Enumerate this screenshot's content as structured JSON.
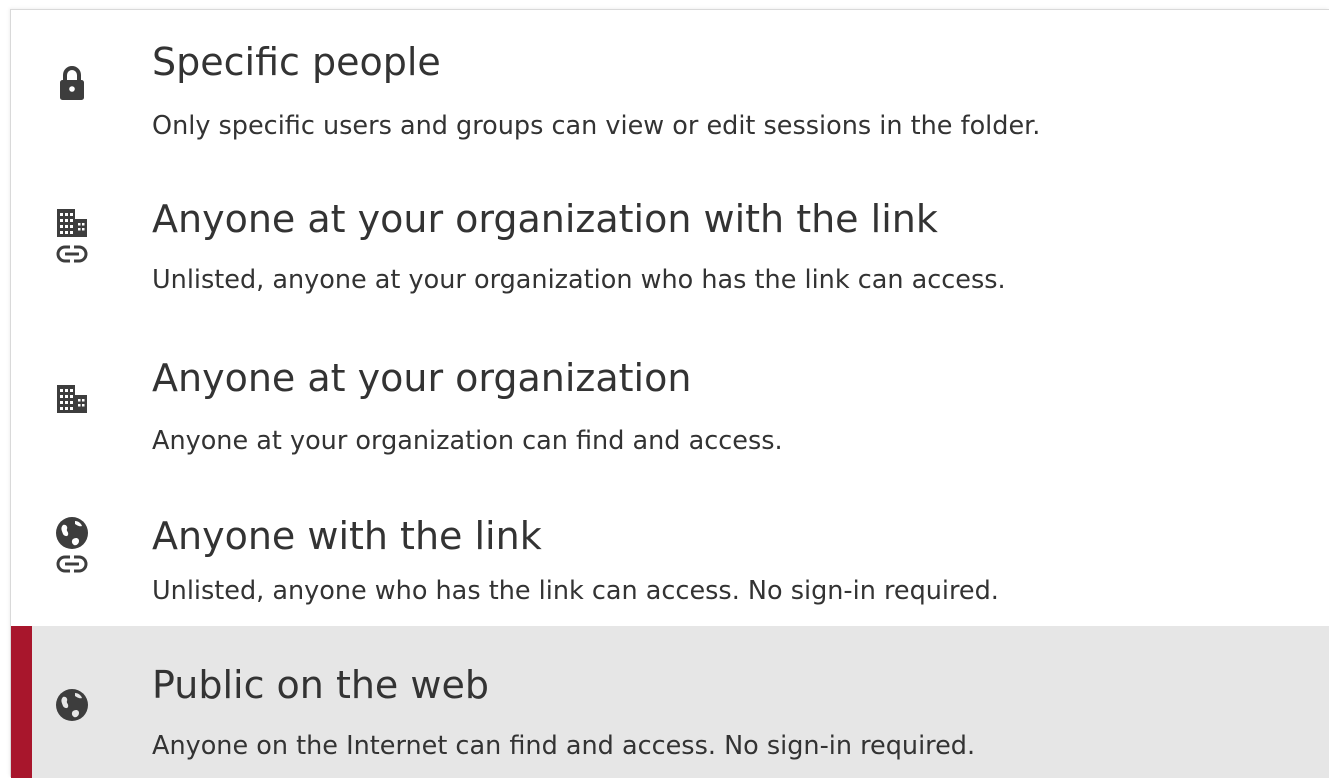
{
  "options": [
    {
      "title": "Specific people",
      "description": "Only specific users and groups can view or edit sessions in the folder.",
      "icons": [
        "lock-icon"
      ],
      "selected": false
    },
    {
      "title": "Anyone at your organization with the link",
      "description": "Unlisted, anyone at your organization who has the link can access.",
      "icons": [
        "building-icon",
        "link-icon"
      ],
      "selected": false
    },
    {
      "title": "Anyone at your organization",
      "description": "Anyone at your organization can find and access.",
      "icons": [
        "building-icon"
      ],
      "selected": false
    },
    {
      "title": "Anyone with the link",
      "description": "Unlisted, anyone who has the link can access. No sign-in required.",
      "icons": [
        "globe-icon",
        "link-icon"
      ],
      "selected": false
    },
    {
      "title": "Public on the web",
      "description": "Anyone on the Internet can find and access. No sign-in required.",
      "icons": [
        "globe-icon"
      ],
      "selected": true
    }
  ],
  "colors": {
    "accent": "#a8162c",
    "selected_background": "#e6e6e6",
    "text": "#333333",
    "icon": "#3d3d3d"
  }
}
